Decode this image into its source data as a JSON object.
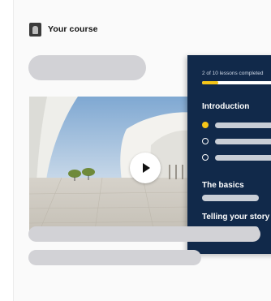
{
  "header": {
    "title": "Your course",
    "logo_icon": "app-logo-icon"
  },
  "video": {
    "play_icon": "play-icon"
  },
  "course_panel": {
    "progress_text": "2 of 10 lessons completed",
    "progress_fraction": 0.2,
    "sections": [
      {
        "title": "Introduction",
        "lessons": [
          {
            "state": "current"
          },
          {
            "state": "not-started"
          },
          {
            "state": "not-started"
          }
        ]
      },
      {
        "title": "The basics"
      },
      {
        "title": "Telling your story"
      }
    ]
  },
  "colors": {
    "panel_background": "#11294a",
    "accent": "#f5c518",
    "skeleton": "#d2d2d6"
  }
}
